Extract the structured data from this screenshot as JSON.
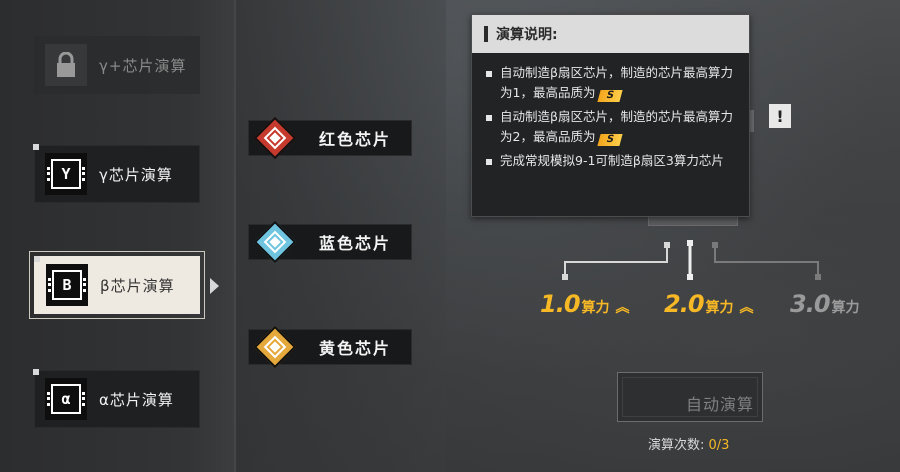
{
  "categories": [
    {
      "label": "γ+芯片演算",
      "icon": "lock-icon",
      "state": "locked"
    },
    {
      "label": "γ芯片演算",
      "icon": "chip-gamma-icon",
      "glyph": "Y",
      "state": "normal"
    },
    {
      "label": "β芯片演算",
      "icon": "chip-beta-icon",
      "glyph": "B",
      "state": "selected"
    },
    {
      "label": "α芯片演算",
      "icon": "chip-alpha-icon",
      "glyph": "α",
      "state": "normal"
    }
  ],
  "chips": [
    {
      "label": "红色芯片",
      "icon": "red-chip-icon",
      "color": "#e04a3c"
    },
    {
      "label": "蓝色芯片",
      "icon": "blue-chip-icon",
      "color": "#6fc4df"
    },
    {
      "label": "黄色芯片",
      "icon": "yellow-chip-icon",
      "color": "#f0b43a"
    }
  ],
  "info": {
    "title": "演算说明:",
    "items": [
      {
        "text": "自动制造β扇区芯片，制造的芯片最高算力为1，最高品质为",
        "grade": "S"
      },
      {
        "text": "自动制造β扇区芯片，制造的芯片最高算力为2，最高品质为",
        "grade": "S"
      },
      {
        "text": "完成常规模拟9-1可制造β扇区3算力芯片",
        "grade": ""
      }
    ]
  },
  "alert_label": "!",
  "power_options": [
    {
      "value": "1.0",
      "unit": "算力",
      "state": "active",
      "chevron": "^^"
    },
    {
      "value": "2.0",
      "unit": "算力",
      "state": "active",
      "chevron": "^^"
    },
    {
      "value": "3.0",
      "unit": "算力",
      "state": "locked",
      "chevron": ""
    }
  ],
  "auto_button": {
    "label": "自动演算"
  },
  "count": {
    "label": "演算次数:",
    "value": "0/3"
  },
  "colors": {
    "accent": "#f6b825",
    "selected_bg": "#efeae1"
  }
}
